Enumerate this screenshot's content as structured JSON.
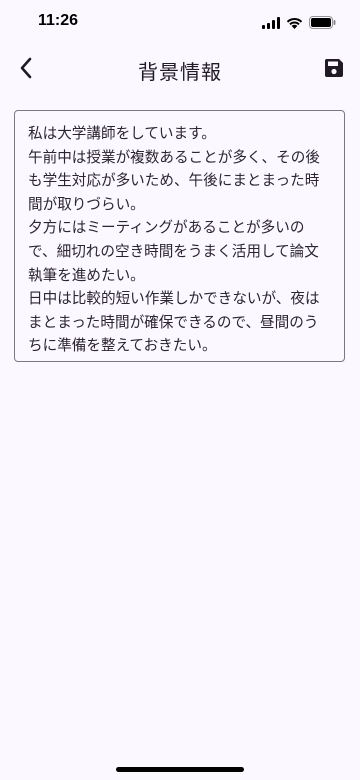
{
  "status_bar": {
    "time": "11:26",
    "signal_icon": "cellular-signal-icon",
    "wifi_icon": "wifi-icon",
    "battery_icon": "battery-icon"
  },
  "app_bar": {
    "title": "背景情報",
    "back_icon": "chevron-left-icon",
    "save_icon": "floppy-disk-save-icon"
  },
  "background_field": {
    "value": "私は大学講師をしています。\n午前中は授業が複数あることが多く、その後も学生対応が多いため、午後にまとまった時間が取りづらい。\n夕方にはミーティングがあることが多いので、細切れの空き時間をうまく活用して論文執筆を進めたい。\n日中は比較的短い作業しかできないが、夜はまとまった時間が確保できるので、昼間のうちに準備を整えておきたい。"
  },
  "colors": {
    "background": "#fcf8ff",
    "field_border": "#7c7780",
    "text": "#1f1a24"
  }
}
